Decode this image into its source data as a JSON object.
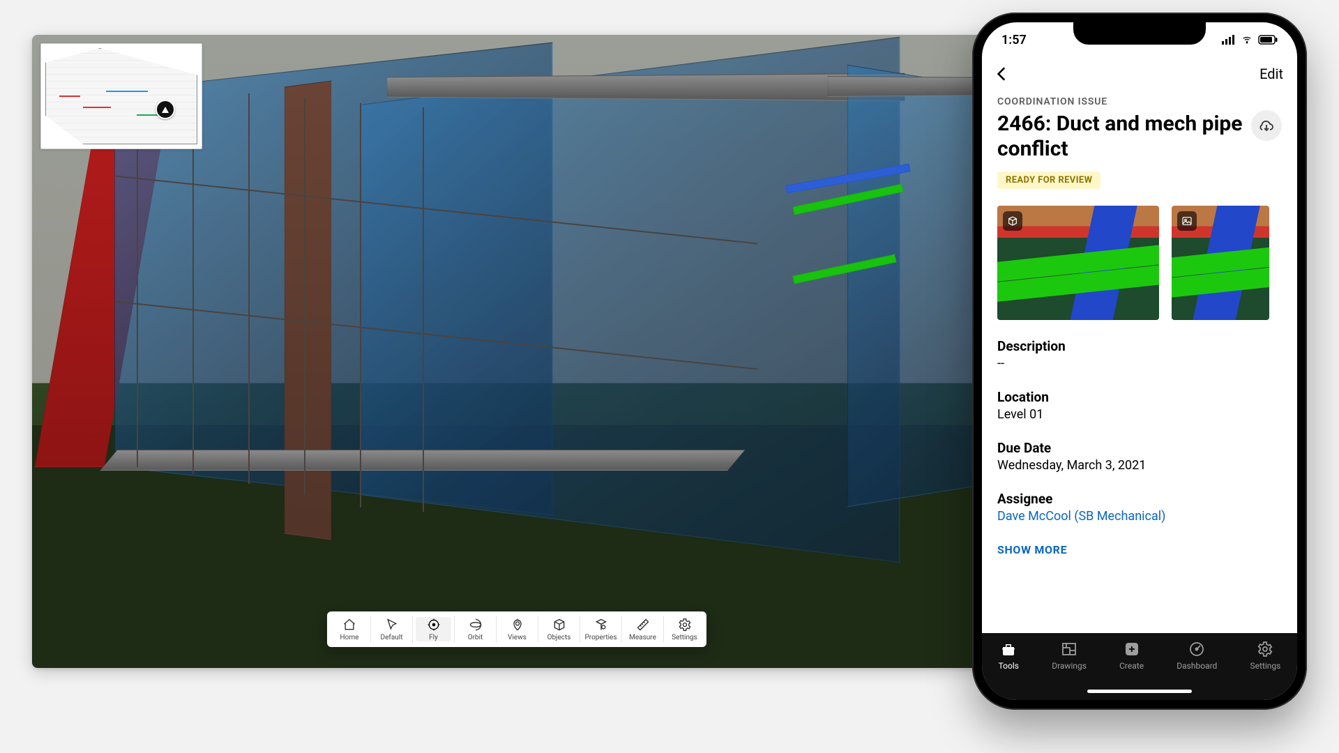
{
  "viewer": {
    "toolbar": [
      {
        "id": "home",
        "label": "Home"
      },
      {
        "id": "default",
        "label": "Default"
      },
      {
        "id": "fly",
        "label": "Fly",
        "active": true
      },
      {
        "id": "orbit",
        "label": "Orbit"
      },
      {
        "id": "views",
        "label": "Views"
      },
      {
        "id": "objects",
        "label": "Objects"
      },
      {
        "id": "properties",
        "label": "Properties"
      },
      {
        "id": "measure",
        "label": "Measure"
      },
      {
        "id": "settings",
        "label": "Settings"
      }
    ]
  },
  "phone": {
    "status_time": "1:57",
    "edit_label": "Edit",
    "issue": {
      "category": "COORDINATION ISSUE",
      "title": "2466: Duct and mech pipe conflict",
      "status_badge": "READY FOR REVIEW",
      "sections": {
        "description_label": "Description",
        "description_value": "--",
        "location_label": "Location",
        "location_value": "Level 01",
        "due_label": "Due Date",
        "due_value": "Wednesday, March 3, 2021",
        "assignee_label": "Assignee",
        "assignee_value": "Dave McCool (SB Mechanical)"
      },
      "show_more": "SHOW MORE"
    },
    "tabs": [
      {
        "id": "tools",
        "label": "Tools",
        "active": true
      },
      {
        "id": "drawings",
        "label": "Drawings"
      },
      {
        "id": "create",
        "label": "Create"
      },
      {
        "id": "dashboard",
        "label": "Dashboard"
      },
      {
        "id": "settings",
        "label": "Settings"
      }
    ]
  }
}
